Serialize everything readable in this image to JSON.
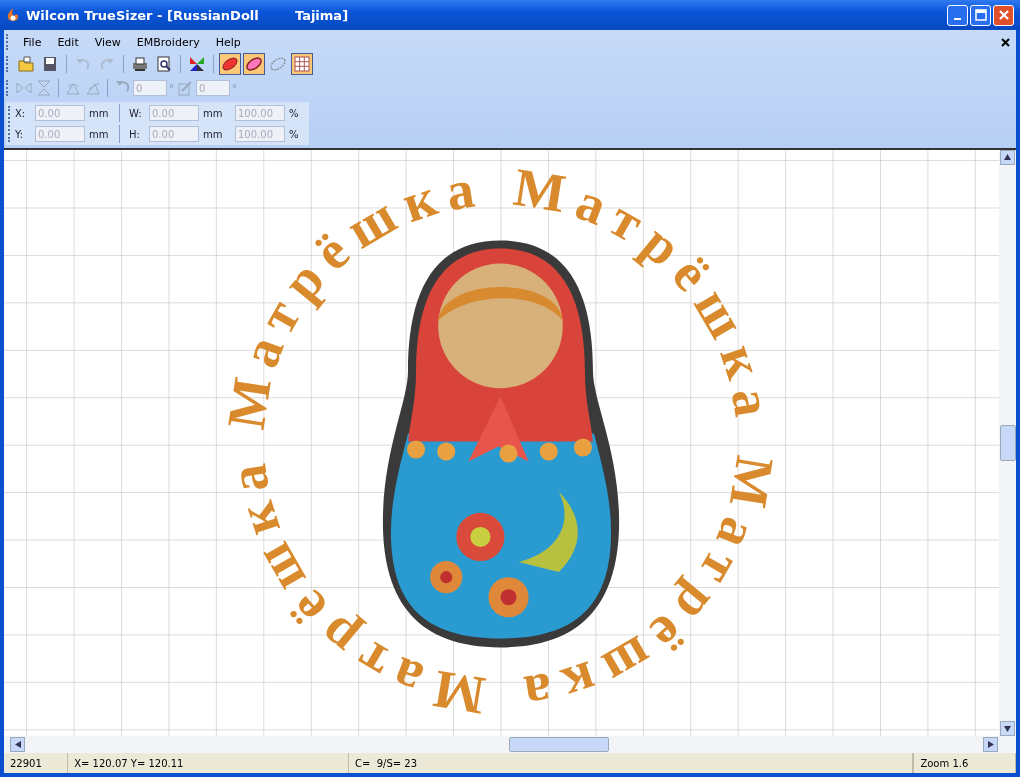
{
  "window": {
    "title": "Wilcom TrueSizer - [RussianDoll        Tajima]"
  },
  "menu": [
    "File",
    "Edit",
    "View",
    "EMBroidery",
    "Help"
  ],
  "toolbar": [
    {
      "kind": "open",
      "disabled": false,
      "on": false
    },
    {
      "kind": "save",
      "disabled": false,
      "on": false
    },
    {
      "kind": "sep"
    },
    {
      "kind": "undo",
      "disabled": true,
      "on": false
    },
    {
      "kind": "redo",
      "disabled": true,
      "on": false
    },
    {
      "kind": "sep"
    },
    {
      "kind": "print",
      "disabled": false,
      "on": false
    },
    {
      "kind": "preview",
      "disabled": false,
      "on": false
    },
    {
      "kind": "sep"
    },
    {
      "kind": "colors",
      "disabled": false,
      "on": false
    },
    {
      "kind": "sep"
    },
    {
      "kind": "leaf-filled",
      "disabled": false,
      "on": true
    },
    {
      "kind": "leaf-outline",
      "disabled": false,
      "on": true
    },
    {
      "kind": "leaf-dashed",
      "disabled": false,
      "on": false
    },
    {
      "kind": "grid",
      "disabled": false,
      "on": true
    }
  ],
  "transform_bar": {
    "rotate_value": "0",
    "rotate_unit": "°",
    "slant_value": "0",
    "slant_unit": "°"
  },
  "position_panel": [
    {
      "axis_label": "X:",
      "value": "0.00",
      "unit": "mm",
      "size_label": "W:",
      "size_value": "0.00",
      "size_unit": "mm",
      "scale": "100.00",
      "scale_unit": "%"
    },
    {
      "axis_label": "Y:",
      "value": "0.00",
      "unit": "mm",
      "size_label": "H:",
      "size_value": "0.00",
      "size_unit": "mm",
      "scale": "100.00",
      "scale_unit": "%"
    }
  ],
  "design": {
    "words": [
      "Матрёшка",
      "Матрёшка",
      "Матрёшка",
      "Матрёшка"
    ]
  },
  "status_bar": [
    "22901",
    "X= 120.07 Y= 120.11",
    "C=  9/S= 23",
    "Zoom 1.6"
  ]
}
